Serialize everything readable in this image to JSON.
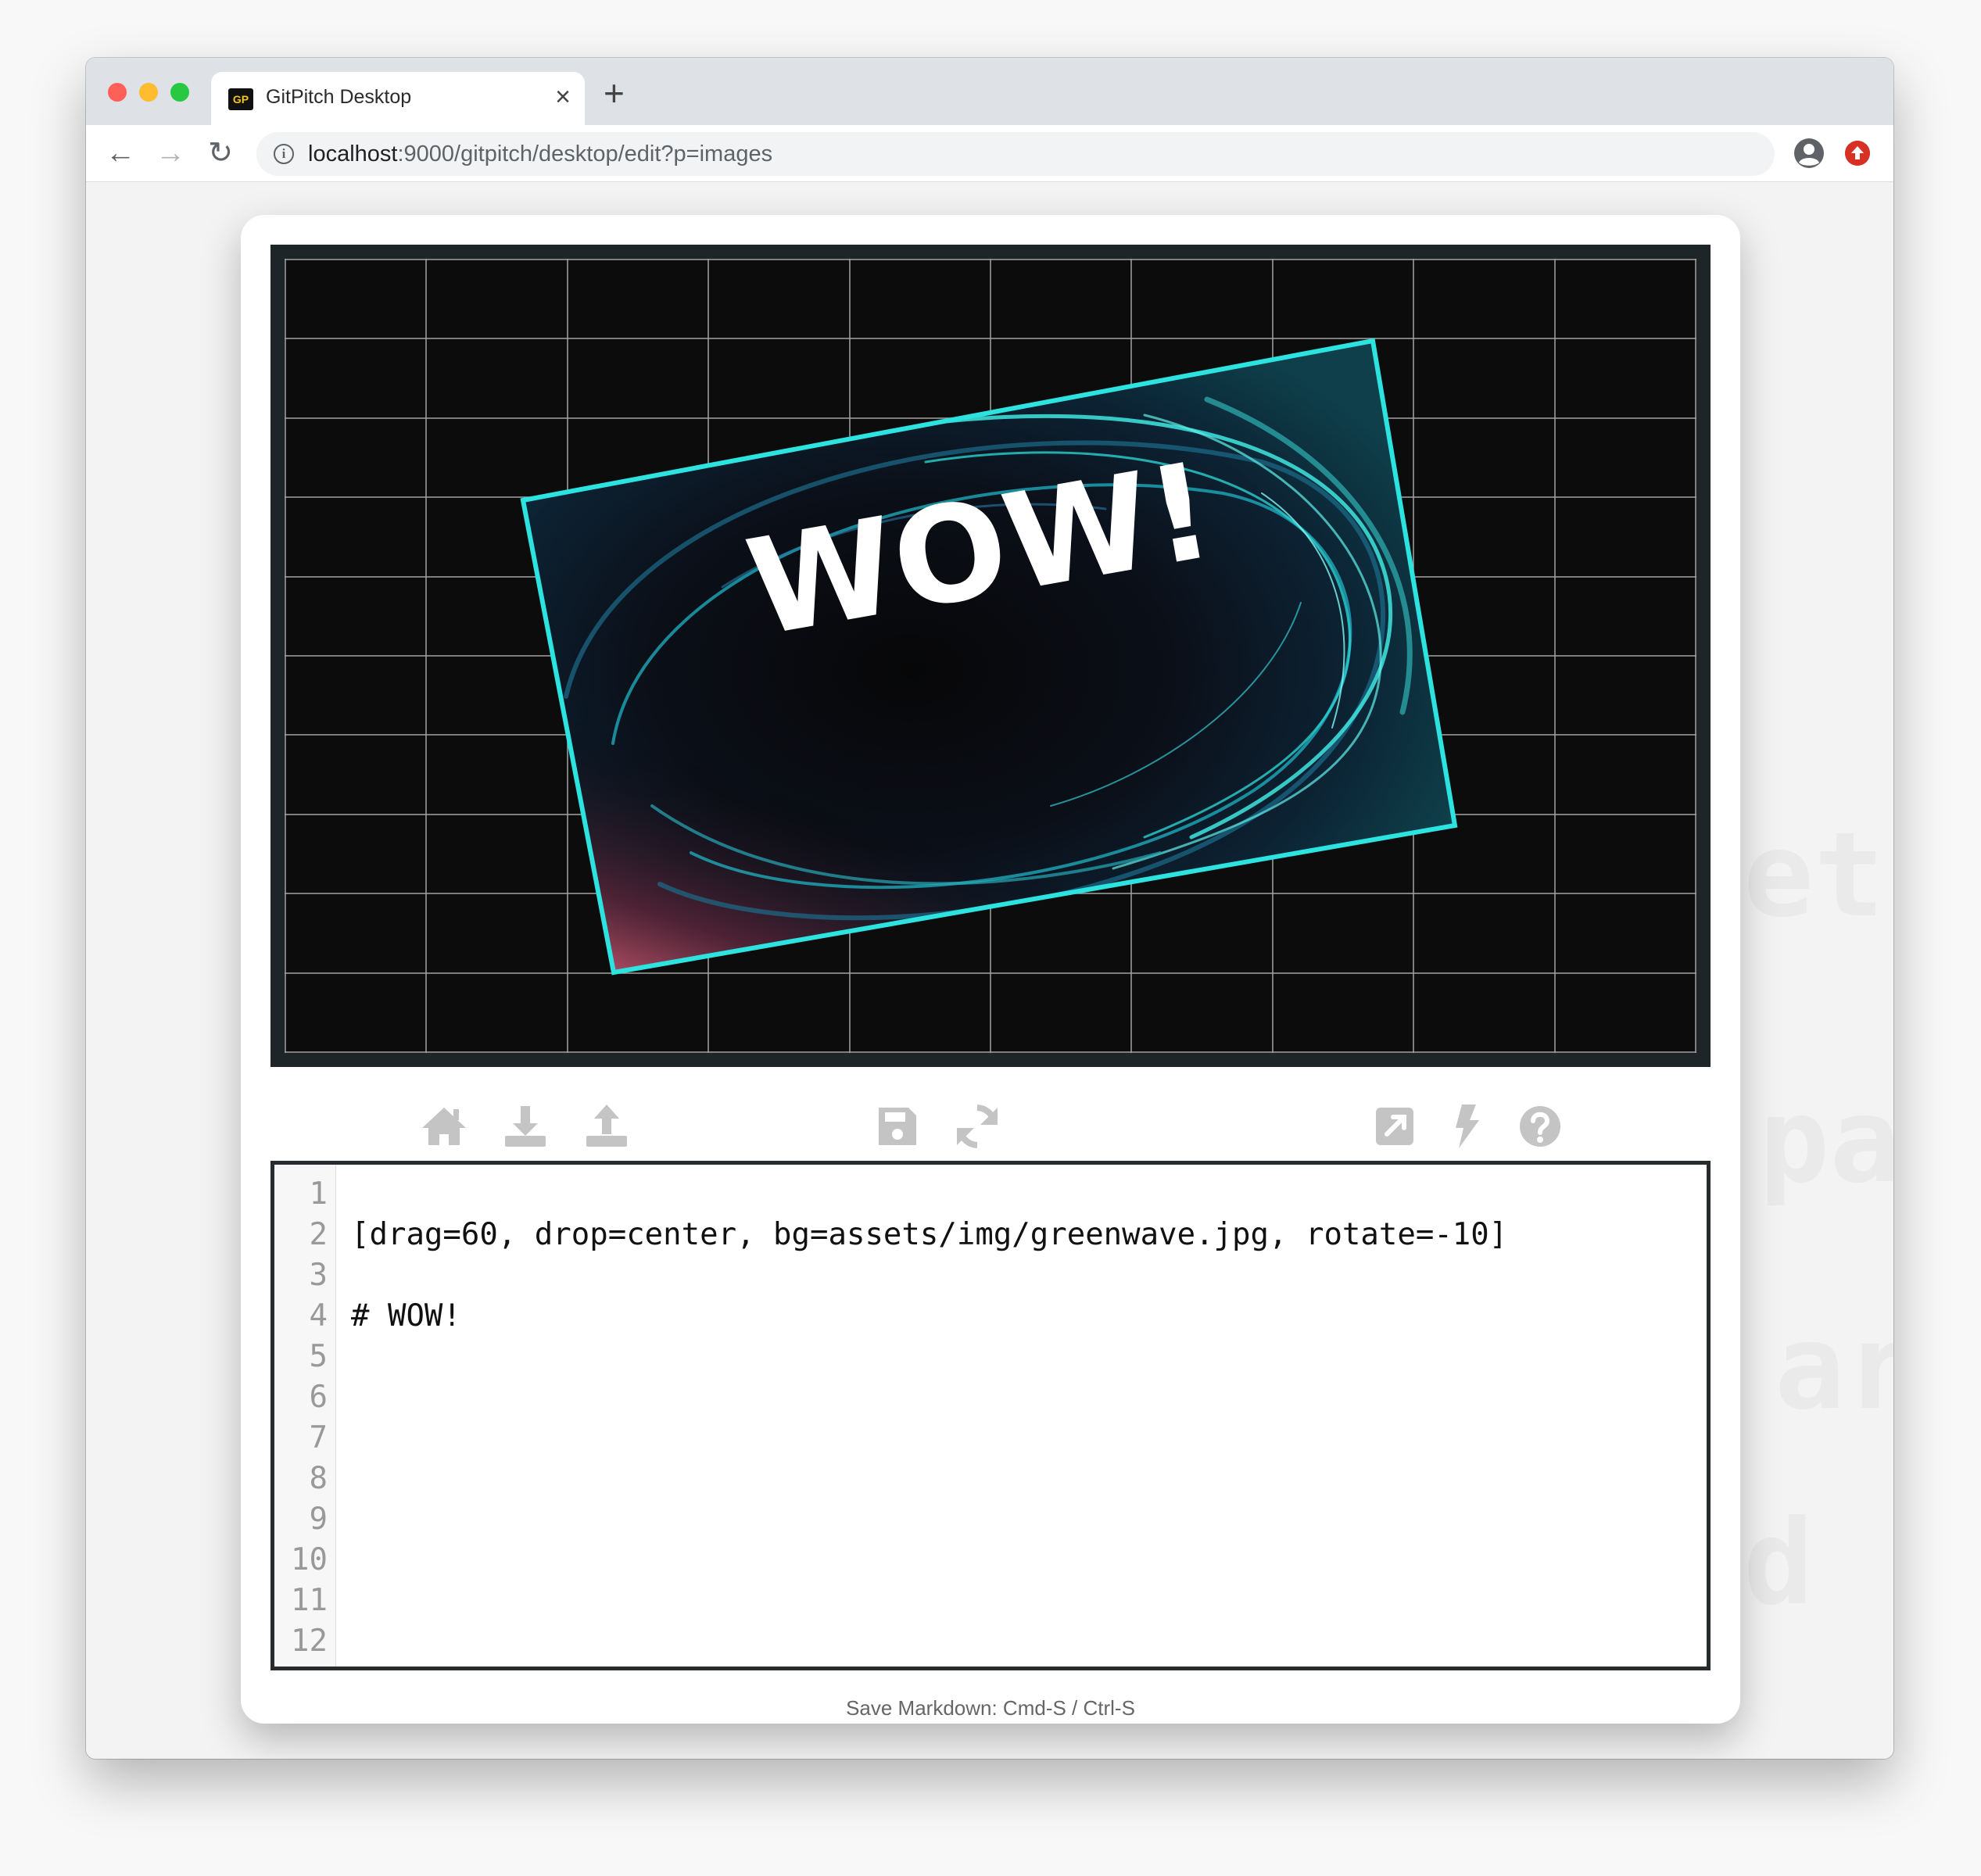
{
  "browser": {
    "tab_favicon_text": "GP",
    "tab_title": "GitPitch Desktop",
    "tab_close_glyph": "×",
    "new_tab_glyph": "+",
    "nav": {
      "back_glyph": "←",
      "forward_glyph": "→",
      "reload_glyph": "↻"
    },
    "url_host": "localhost",
    "url_path": ":9000/gitpitch/desktop/edit?p=images",
    "bookmark_glyph": "☆"
  },
  "slide": {
    "heading": "WOW!",
    "background": "assets/img/greenwave.jpg",
    "rotate_degrees": -10,
    "drag_percent": 60,
    "drop": "center",
    "grid_color": "#bfbfbf",
    "accent_color": "#2de3e0"
  },
  "toolbar": {
    "icons": [
      "home-icon",
      "download-icon",
      "upload-icon",
      "save-icon",
      "refresh-icon",
      "external-link-icon",
      "bolt-icon",
      "help-icon"
    ],
    "icon_color": "#c4c4c4"
  },
  "editor": {
    "line_numbers": [
      "1",
      "2",
      "3",
      "4",
      "5",
      "6",
      "7",
      "8",
      "9",
      "10",
      "11",
      "12"
    ],
    "lines": [
      "",
      "[drag=60, drop=center, bg=assets/img/greenwave.jpg, rotate=-10]",
      "",
      "# WOW!",
      "",
      "",
      "",
      "",
      "",
      "",
      "",
      ""
    ]
  },
  "footer": {
    "hint": "Save Markdown: Cmd-S / Ctrl-S"
  },
  "background_ghost_text": [
    "et",
    "pa",
    "ar",
    "d ("
  ]
}
